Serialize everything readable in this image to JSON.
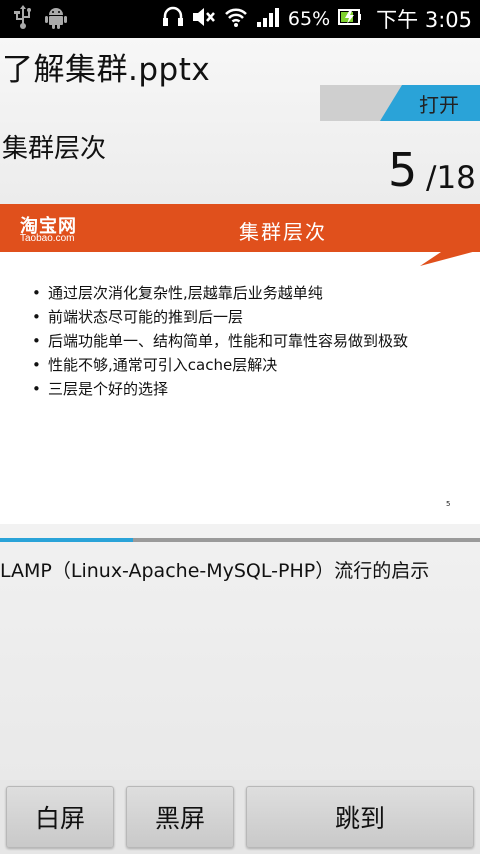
{
  "status_bar": {
    "battery_percent": "65%",
    "time": "下午 3:05",
    "icons": [
      "usb-icon",
      "android-debug-icon",
      "headset-icon",
      "mute-icon",
      "wifi-icon",
      "signal-icon",
      "battery-icon"
    ]
  },
  "header": {
    "file_title": "了解集群.pptx",
    "open_label": "打开",
    "section_title": "集群层次",
    "page_current": "5",
    "page_total": "/18"
  },
  "slide": {
    "logo_cn": "淘宝网",
    "logo_en": "Taobao.com",
    "title": "集群层次",
    "bullets": [
      "通过层次消化复杂性,层越靠后业务越单纯",
      "前端状态尽可能的推到后一层",
      "后端功能单一、结构简单，性能和可靠性容易做到极致",
      "性能不够,通常可引入cache层解决",
      "三层是个好的选择"
    ],
    "slide_number": "5",
    "banner_color": "#e0501c"
  },
  "progress": {
    "fraction": 0.2778,
    "color": "#2aa3d8"
  },
  "notes": {
    "text": "LAMP（Linux-Apache-MySQL-PHP）流行的启示"
  },
  "bottom_bar": {
    "white_screen_label": "白屏",
    "black_screen_label": "黑屏",
    "jump_label": "跳到"
  }
}
